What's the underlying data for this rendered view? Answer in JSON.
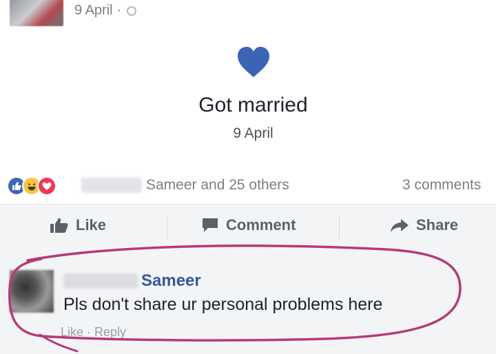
{
  "post": {
    "date": "9 April",
    "separator": "·",
    "event_title": "Got married",
    "event_date": "9 April"
  },
  "stats": {
    "reactors": "Sameer and 25 others",
    "comments": "3 comments"
  },
  "actions": {
    "like": "Like",
    "comment": "Comment",
    "share": "Share"
  },
  "comment": {
    "author": "Sameer",
    "text": "Pls don't share ur personal problems here",
    "actions": "Like · Reply"
  },
  "colors": {
    "heart": "#3b65b4",
    "link": "#365899",
    "marker": "#b53a79"
  },
  "icons": [
    "globe-icon",
    "heart-icon",
    "like-reaction-icon",
    "haha-reaction-icon",
    "love-reaction-icon",
    "thumbs-up-icon",
    "comment-icon",
    "share-arrow-icon"
  ]
}
